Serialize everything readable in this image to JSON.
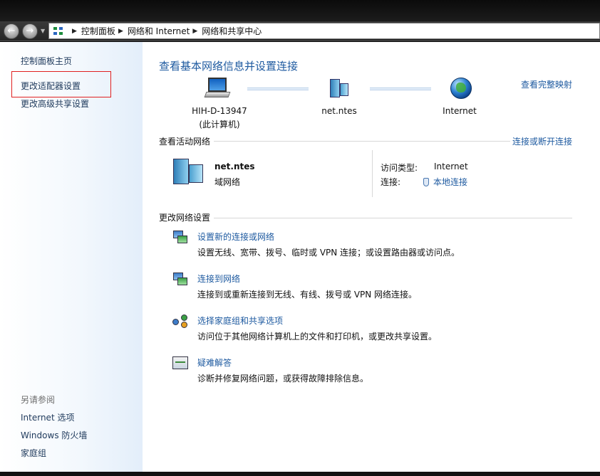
{
  "address": {
    "crumbs": [
      "控制面板",
      "网络和 Internet",
      "网络和共享中心"
    ]
  },
  "sidebar": {
    "home": "控制面板主页",
    "adapter": "更改适配器设置",
    "advanced": "更改高级共享设置",
    "see_also": "另请参阅",
    "links": [
      "Internet 选项",
      "Windows 防火墙",
      "家庭组"
    ]
  },
  "main": {
    "title": "查看基本网络信息并设置连接",
    "full_map": "查看完整映射",
    "map": {
      "computer_name": "HIH-D-13947",
      "computer_note": "(此计算机)",
      "network": "net.ntes",
      "internet": "Internet"
    },
    "active": {
      "label": "查看活动网络",
      "connect_link": "连接或断开连接",
      "network_name": "net.ntes",
      "network_type": "域网络",
      "access_label": "访问类型:",
      "access_value": "Internet",
      "conn_label": "连接:",
      "conn_value": "本地连接"
    },
    "change": {
      "label": "更改网络设置",
      "tasks": [
        {
          "title": "设置新的连接或网络",
          "desc": "设置无线、宽带、拨号、临时或 VPN 连接；或设置路由器或访问点。"
        },
        {
          "title": "连接到网络",
          "desc": "连接到或重新连接到无线、有线、拨号或 VPN 网络连接。"
        },
        {
          "title": "选择家庭组和共享选项",
          "desc": "访问位于其他网络计算机上的文件和打印机，或更改共享设置。"
        },
        {
          "title": "疑难解答",
          "desc": "诊断并修复网络问题，或获得故障排除信息。"
        }
      ]
    }
  }
}
